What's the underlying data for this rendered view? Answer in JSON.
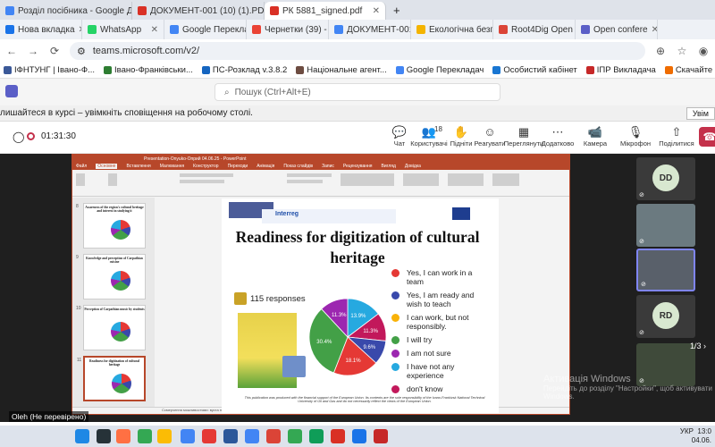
{
  "browser": {
    "tabs_row1": [
      {
        "label": "Розділ посібника - Google Доку",
        "color": "#4285f4",
        "active": false
      },
      {
        "label": "ДОКУМЕНТ-001 (10) (1).PDF",
        "color": "#d93025",
        "active": false
      },
      {
        "label": "РК 5881_signed.pdf",
        "color": "#d93025",
        "active": true
      }
    ],
    "tabs_row2": [
      {
        "label": "Нова вкладка",
        "color": "#1a73e8"
      },
      {
        "label": "WhatsApp",
        "color": "#25d366"
      },
      {
        "label": "Google Перекладач",
        "color": "#4285f4"
      },
      {
        "label": "Чернетки (39) - ",
        "color": "#ea4335"
      },
      {
        "label": "ДОКУМЕНТ-001",
        "color": "#4285f4"
      },
      {
        "label": "Екологічна безп",
        "color": "#f4b400"
      },
      {
        "label": "Root4Dig Open C",
        "color": "#db4437"
      },
      {
        "label": "Open confere",
        "color": "#5b5fc7"
      }
    ],
    "url": "teams.microsoft.com/v2/",
    "bookmarks": [
      {
        "label": "ІФНТУНГ | Івано-Ф...",
        "color": "#3b5998"
      },
      {
        "label": "Івано-Франківськи...",
        "color": "#2e7d32"
      },
      {
        "label": "ПС-Розклад v.3.8.2",
        "color": "#1565c0"
      },
      {
        "label": "Національне агент...",
        "color": "#6d4c41"
      },
      {
        "label": "Google Перекладач",
        "color": "#4285f4"
      },
      {
        "label": "Особистий кабінет",
        "color": "#1976d2"
      },
      {
        "label": "ІПР Викладача",
        "color": "#c62828"
      },
      {
        "label": "Скачайте ваш пере...",
        "color": "#ef6c00"
      },
      {
        "label": "WhatsApp",
        "color": "#25d366"
      },
      {
        "label": "Telegram",
        "color": "#2aa3df"
      }
    ]
  },
  "teams": {
    "search_placeholder": "Пошук (Ctrl+Alt+E)",
    "notice": "лишайтеся в курсі – увімкніть сповіщення на робочому столі.",
    "notice_button": "Увім",
    "timer": "01:31:30",
    "controls": [
      {
        "label": "Чат",
        "icon": "chat-icon",
        "glyph": "💬"
      },
      {
        "label": "Користувачі",
        "icon": "people-icon",
        "glyph": "👥"
      },
      {
        "label": "Підніти",
        "icon": "raise-hand-icon",
        "glyph": "✋"
      },
      {
        "label": "Реагувати",
        "icon": "react-icon",
        "glyph": "☺"
      },
      {
        "label": "Переглянути",
        "icon": "view-icon",
        "glyph": "▦"
      },
      {
        "label": "Додатково",
        "icon": "more-icon",
        "glyph": "⋯"
      },
      {
        "label": "Камера",
        "icon": "camera-icon",
        "glyph": "📹"
      },
      {
        "label": "Мікрофон",
        "icon": "mic-icon",
        "glyph": "🎙"
      },
      {
        "label": "Поділитися",
        "icon": "share-icon",
        "glyph": "⇧"
      }
    ],
    "participant_count": "18",
    "gallery": [
      {
        "initials": "DD",
        "bg": "#d8e8d0"
      },
      {
        "initials": "",
        "bg": "#6b7a80"
      },
      {
        "initials": "",
        "bg": "#59606a"
      },
      {
        "initials": "RD",
        "bg": "#d8e8d0"
      },
      {
        "initials": "",
        "bg": "#3f4a3a"
      }
    ],
    "pager": "1/3",
    "caption": "Oleh (Не перевірено)",
    "watermark_title": "Активація Windows",
    "watermark_sub": "Перейдіть до розділу \"Настройки\", щоб активувати Windows."
  },
  "ppt": {
    "window_title": "Presentation-Onyuko-Оприй 04.06.25 - PowerPoint",
    "menu": [
      "Файл",
      "Основне",
      "Вставлення",
      "Малювання",
      "Конструктор",
      "Переходи",
      "Анімація",
      "Показ слайдів",
      "Запис",
      "Рецензування",
      "Вигляд",
      "Довідка"
    ],
    "thumbs": [
      {
        "num": "8",
        "title": "Awareness of the region's cultural heritage and interest in studying it"
      },
      {
        "num": "9",
        "title": "Knowledge and perception of Carpathian cuisine"
      },
      {
        "num": "10",
        "title": "Perception of Carpathian music by students"
      },
      {
        "num": "11",
        "title": "Readiness for digitization of cultural heritage"
      }
    ],
    "status": "Ссмерчення можливостями: вуста не ста"
  },
  "slide": {
    "title": "Readiness for digitization of cultural heritage",
    "responses": "115 responses",
    "logo_text": "Interreg",
    "disclaimer": "This publication was produced with the financial support of the European Union. Its contents are the sole responsibility of the Ivano-Frankivsk National Technical University of Oil and Gas and do not necessarily reflect the views of the European Union."
  },
  "chart_data": {
    "type": "pie",
    "title": "",
    "labels": [
      "Yes, I can work in a team",
      "Yes, I am ready and wish to teach",
      "I can work, but not responsibly.",
      "I will try",
      "I am not sure",
      "I have not any experience",
      "don't know"
    ],
    "colors": [
      "#e53935",
      "#3949ab",
      "#f9b208",
      "#43a047",
      "#9c27b0",
      "#26a9e0",
      "#c2185b"
    ],
    "values": [
      18.1,
      9.6,
      0,
      30.4,
      11.3,
      13.9,
      11.3
    ],
    "data_labels": [
      "18.1%",
      "9.6%",
      "",
      "30.4%",
      "11.3%",
      "13.9%",
      "11.3%"
    ]
  },
  "taskbar": {
    "time": "13:0",
    "date": "04.06.",
    "lang": "УКР"
  }
}
